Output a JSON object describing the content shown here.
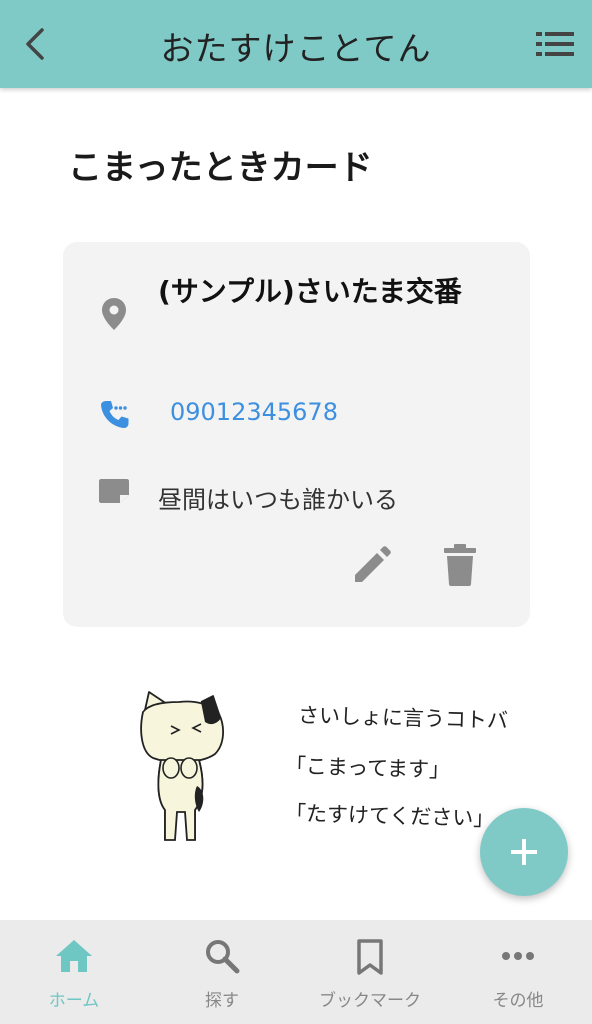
{
  "header": {
    "title": "おたすけことてん",
    "back_icon": "chevron-left-icon",
    "menu_icon": "list-menu-icon"
  },
  "page": {
    "title": "こまったときカード"
  },
  "card": {
    "name": "(サンプル)さいたま交番",
    "phone": "09012345678",
    "memo": "昼間はいつも誰かいる",
    "icons": [
      "location-pin-icon",
      "phone-icon",
      "note-icon",
      "pencil-icon",
      "trash-icon"
    ]
  },
  "illustration": {
    "caption_line1": "さいしょに言うコトバ",
    "caption_line2": "「こまってます」",
    "caption_line3": "「たすけてください」"
  },
  "fab": {
    "icon": "plus-icon"
  },
  "bottom_nav": {
    "items": [
      {
        "label": "ホーム",
        "icon": "home-icon",
        "active": true
      },
      {
        "label": "探す",
        "icon": "search-icon",
        "active": false
      },
      {
        "label": "ブックマーク",
        "icon": "bookmark-icon",
        "active": false
      },
      {
        "label": "その他",
        "icon": "more-icon",
        "active": false
      }
    ]
  },
  "colors": {
    "accent": "#7fcac7",
    "phone_link": "#3d8fe0",
    "card_bg": "#f3f3f3",
    "nav_bg": "#ebebeb",
    "icon_gray": "#8c8c8c"
  }
}
